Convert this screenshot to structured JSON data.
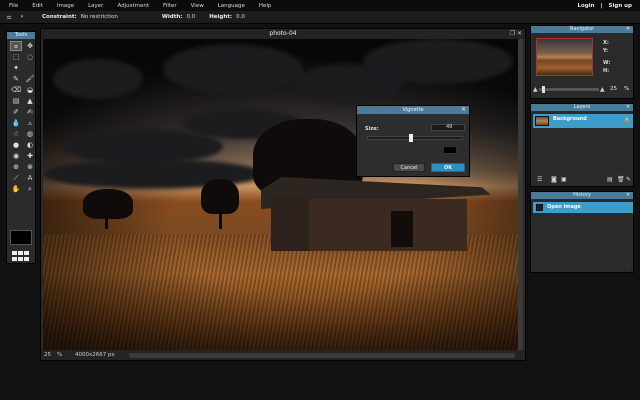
{
  "menubar": {
    "items": [
      "File",
      "Edit",
      "Image",
      "Layer",
      "Adjustment",
      "Filter",
      "View",
      "Language",
      "Help"
    ],
    "login": "Login",
    "separator": "|",
    "signup": "Sign up"
  },
  "optionsbar": {
    "constraint_label": "Constraint:",
    "constraint_value": "No restriction",
    "width_label": "Width:",
    "width_value": "0.0",
    "height_label": "Height:",
    "height_value": "0.0"
  },
  "tools": {
    "title": "Tools",
    "items": [
      {
        "name": "crop-tool-icon",
        "glyph": "⌗",
        "active": true
      },
      {
        "name": "move-tool-icon",
        "glyph": "✥",
        "active": false
      },
      {
        "name": "marquee-tool-icon",
        "glyph": "⬚",
        "active": false
      },
      {
        "name": "lasso-tool-icon",
        "glyph": "◌",
        "active": false
      },
      {
        "name": "magic-wand-tool-icon",
        "glyph": "✦",
        "active": false
      },
      {
        "name": "blank-tool-slot",
        "glyph": "",
        "active": false
      },
      {
        "name": "pencil-tool-icon",
        "glyph": "✎",
        "active": false
      },
      {
        "name": "brush-tool-icon",
        "glyph": "🖌",
        "active": false
      },
      {
        "name": "eraser-tool-icon",
        "glyph": "⌫",
        "active": false
      },
      {
        "name": "bucket-tool-icon",
        "glyph": "◒",
        "active": false
      },
      {
        "name": "gradient-tool-icon",
        "glyph": "▤",
        "active": false
      },
      {
        "name": "clone-stamp-tool-icon",
        "glyph": "▲",
        "active": false
      },
      {
        "name": "color-replace-tool-icon",
        "glyph": "✐",
        "active": false
      },
      {
        "name": "draw-tool-icon",
        "glyph": "✍",
        "active": false
      },
      {
        "name": "blur-tool-icon",
        "glyph": "💧",
        "active": false
      },
      {
        "name": "sharpen-tool-icon",
        "glyph": "▵",
        "active": false
      },
      {
        "name": "smudge-tool-icon",
        "glyph": "☝",
        "active": false
      },
      {
        "name": "sponge-tool-icon",
        "glyph": "◍",
        "active": false
      },
      {
        "name": "dodge-tool-icon",
        "glyph": "●",
        "active": false
      },
      {
        "name": "burn-tool-icon",
        "glyph": "◐",
        "active": false
      },
      {
        "name": "red-eye-tool-icon",
        "glyph": "◉",
        "active": false
      },
      {
        "name": "spot-heal-tool-icon",
        "glyph": "✚",
        "active": false
      },
      {
        "name": "bloat-tool-icon",
        "glyph": "⊕",
        "active": false
      },
      {
        "name": "pinch-tool-icon",
        "glyph": "⊗",
        "active": false
      },
      {
        "name": "eyedropper-tool-icon",
        "glyph": "⟋",
        "active": false
      },
      {
        "name": "type-tool-icon",
        "glyph": "A",
        "active": false
      },
      {
        "name": "hand-tool-icon",
        "glyph": "✋",
        "active": false
      },
      {
        "name": "zoom-tool-icon",
        "glyph": "⌕",
        "active": false
      }
    ],
    "primary_color": "#000000"
  },
  "image_window": {
    "title": "photo-04",
    "zoom": "25",
    "zoom_unit": "%",
    "dimensions": "4000x2667 px"
  },
  "vignette_dialog": {
    "title": "Vignette",
    "size_label": "Size:",
    "size_value": "49",
    "size_fraction": 0.45,
    "cancel_label": "Cancel",
    "ok_label": "OK",
    "color": "#000000"
  },
  "navigator": {
    "title": "Navigator",
    "x_label": "X:",
    "y_label": "Y:",
    "w_label": "W:",
    "h_label": "H:",
    "zoom_value": "25",
    "zoom_unit": "%",
    "zoom_fraction": 0.05
  },
  "layers": {
    "title": "Layers",
    "items": [
      {
        "name": "Background",
        "locked": true
      }
    ]
  },
  "history": {
    "title": "History",
    "items": [
      {
        "name": "Open image"
      }
    ]
  },
  "colors": {
    "panel_header": "#4a7c9a",
    "selection": "#3d9cc8",
    "ok_button": "#2e8fbd"
  }
}
